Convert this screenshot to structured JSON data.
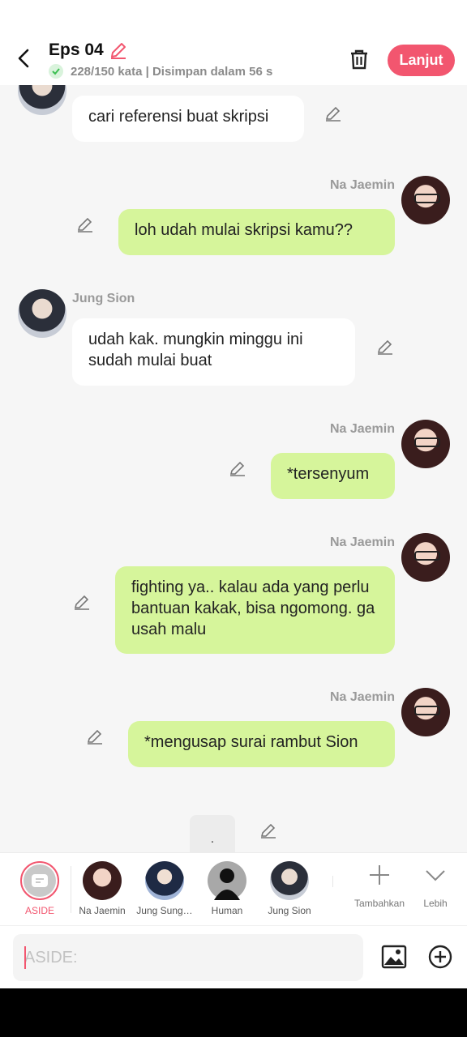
{
  "header": {
    "title": "Eps 04",
    "status": "228/150 kata | Disimpan dalam 56 s",
    "next_label": "Lanjut"
  },
  "messages": [
    {
      "side": "left",
      "speaker": "",
      "text": "cari referensi buat skripsi"
    },
    {
      "side": "right",
      "speaker": "Na Jaemin",
      "text": "loh udah mulai skripsi kamu??"
    },
    {
      "side": "left",
      "speaker": "Jung Sion",
      "text": "udah kak. mungkin minggu ini sudah mulai buat"
    },
    {
      "side": "right",
      "speaker": "Na Jaemin",
      "text": "*tersenyum"
    },
    {
      "side": "right",
      "speaker": "Na Jaemin",
      "text": "fighting ya.. kalau ada yang perlu bantuan kakak, bisa ngomong. ga usah malu"
    },
    {
      "side": "right",
      "speaker": "Na Jaemin",
      "text": "*mengusap surai rambut Sion"
    },
    {
      "side": "center",
      "speaker": "",
      "text": "."
    }
  ],
  "characters": [
    {
      "label": "ASIDE",
      "icon": "aside-icon"
    },
    {
      "label": "Na Jaemin",
      "icon": "avatar"
    },
    {
      "label": "Jung Sung…",
      "icon": "avatar"
    },
    {
      "label": "Human",
      "icon": "human-silhouette-icon"
    },
    {
      "label": "Jung Sion",
      "icon": "avatar"
    }
  ],
  "tools": {
    "add_label": "Tambahkan",
    "more_label": "Lebih"
  },
  "input": {
    "placeholder": "ASIDE:"
  },
  "colors": {
    "accent": "#f2566f",
    "right_bubble": "#d6f59b",
    "left_bubble": "#ffffff",
    "background": "#f6f6f6"
  }
}
